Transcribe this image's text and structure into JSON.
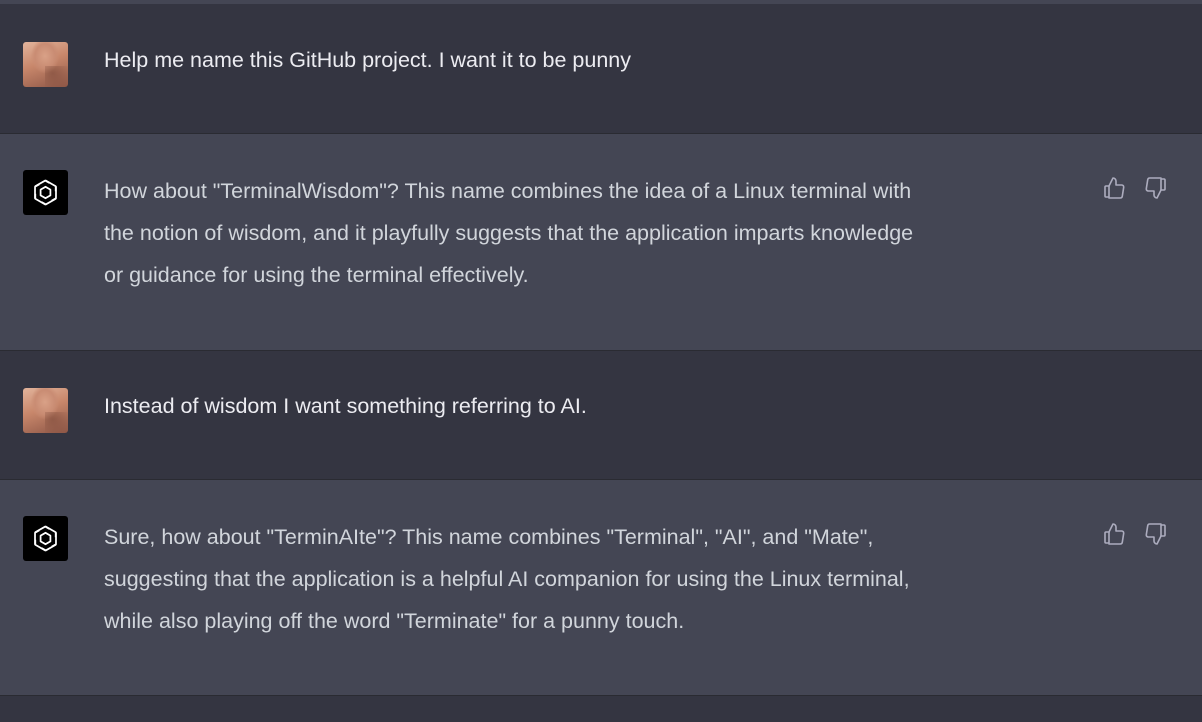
{
  "colors": {
    "user_row_bg": "#343541",
    "assistant_row_bg": "#444654",
    "user_text": "#ececf1",
    "assistant_text": "#d1d5db",
    "icon": "#acacbe"
  },
  "messages": [
    {
      "role": "user",
      "avatar": "user-avatar-photo",
      "lines": [
        "Help me name this GitHub project.  I want it to be punny"
      ]
    },
    {
      "role": "assistant",
      "avatar": "openai-logo-icon",
      "lines": [
        "How about \"TerminalWisdom\"? This name combines the idea of a Linux terminal with",
        "the notion of wisdom, and it playfully suggests that the application imparts knowledge",
        "or guidance for using the terminal effectively."
      ],
      "actions": [
        "thumbs-up-icon",
        "thumbs-down-icon"
      ]
    },
    {
      "role": "user",
      "avatar": "user-avatar-photo",
      "lines": [
        "Instead of wisdom I want something referring to AI."
      ]
    },
    {
      "role": "assistant",
      "avatar": "openai-logo-icon",
      "lines": [
        "Sure, how about \"TerminAIte\"? This name combines \"Terminal\", \"AI\", and \"Mate\",",
        "suggesting that the application is a helpful AI companion for using the Linux terminal,",
        "while also playing off the word \"Terminate\" for a punny touch."
      ],
      "actions": [
        "thumbs-up-icon",
        "thumbs-down-icon"
      ]
    }
  ]
}
